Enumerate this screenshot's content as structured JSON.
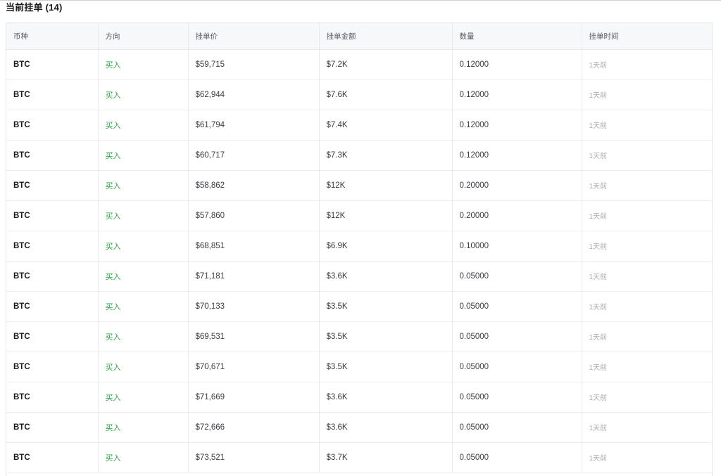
{
  "section": {
    "title": "当前挂单 (14)"
  },
  "table": {
    "columns": [
      "币种",
      "方向",
      "挂单价",
      "挂单金额",
      "数量",
      "挂单时间"
    ],
    "rows": [
      [
        "BTC",
        "买入",
        "$59,715",
        "$7.2K",
        "0.12000",
        "1天前"
      ],
      [
        "BTC",
        "买入",
        "$62,944",
        "$7.6K",
        "0.12000",
        "1天前"
      ],
      [
        "BTC",
        "买入",
        "$61,794",
        "$7.4K",
        "0.12000",
        "1天前"
      ],
      [
        "BTC",
        "买入",
        "$60,717",
        "$7.3K",
        "0.12000",
        "1天前"
      ],
      [
        "BTC",
        "买入",
        "$58,862",
        "$12K",
        "0.20000",
        "1天前"
      ],
      [
        "BTC",
        "买入",
        "$57,860",
        "$12K",
        "0.20000",
        "1天前"
      ],
      [
        "BTC",
        "买入",
        "$68,851",
        "$6.9K",
        "0.10000",
        "1天前"
      ],
      [
        "BTC",
        "买入",
        "$71,181",
        "$3.6K",
        "0.05000",
        "1天前"
      ],
      [
        "BTC",
        "买入",
        "$70,133",
        "$3.5K",
        "0.05000",
        "1天前"
      ],
      [
        "BTC",
        "买入",
        "$69,531",
        "$3.5K",
        "0.05000",
        "1天前"
      ],
      [
        "BTC",
        "买入",
        "$70,671",
        "$3.5K",
        "0.05000",
        "1天前"
      ],
      [
        "BTC",
        "买入",
        "$71,669",
        "$3.6K",
        "0.05000",
        "1天前"
      ],
      [
        "BTC",
        "买入",
        "$72,666",
        "$3.6K",
        "0.05000",
        "1天前"
      ],
      [
        "BTC",
        "买入",
        "$73,521",
        "$3.7K",
        "0.05000",
        "1天前"
      ]
    ]
  },
  "colors": {
    "buy": "#2e9e47",
    "header_bg": "#f7f8fa",
    "muted": "#a6a9ae",
    "border": "#e4e6ea"
  }
}
